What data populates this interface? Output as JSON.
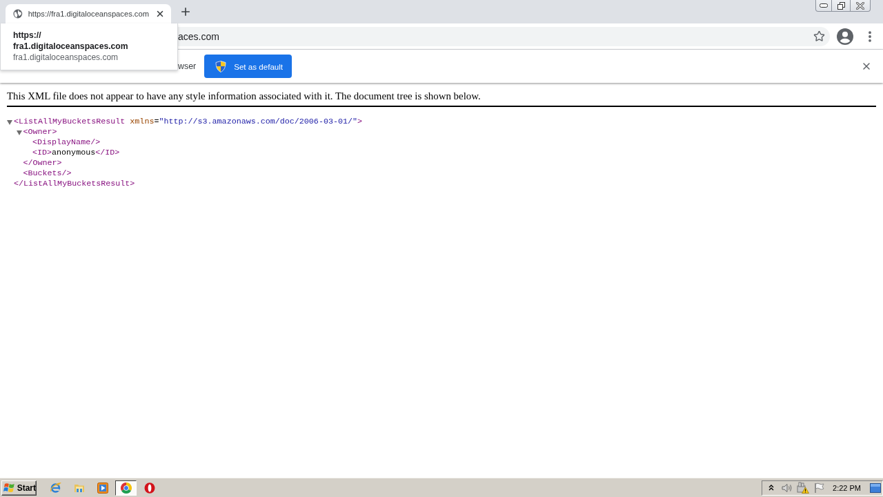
{
  "tabs": [
    {
      "title": "https://fra1.digitaloceanspaces.com",
      "selected": true
    }
  ],
  "hover_card": {
    "title_lines": [
      "https://",
      "fra1.digitaloceanspaces.com"
    ],
    "subtitle": "fra1.digitaloceanspaces.com"
  },
  "toolbar": {
    "address": "aces.com"
  },
  "infobar": {
    "message": "wser",
    "button": "Set as default"
  },
  "page": {
    "notice": "This XML file does not appear to have any style information associated with it. The document tree is shown below.",
    "xml_tree": [
      {
        "kind": "parent",
        "expanded": true,
        "open": [
          {
            "kind": "tag",
            "text": "<ListAllMyBucketsResult"
          },
          {
            "kind": "attr_name",
            "text": "xmlns"
          },
          {
            "kind": "text",
            "text": "="
          },
          {
            "kind": "attr_value",
            "text": "\"http://s3.amazonaws.com/doc/2006-03-01/\""
          },
          {
            "kind": "tag",
            "text": ">"
          }
        ],
        "children": [
          {
            "kind": "parent",
            "expanded": true,
            "open": [
              {
                "kind": "tag",
                "text": "<Owner>"
              }
            ],
            "children": [
              {
                "kind": "leaf",
                "line": [
                  {
                    "kind": "tag",
                    "text": "<DisplayName/>"
                  }
                ]
              },
              {
                "kind": "leaf",
                "line": [
                  {
                    "kind": "tag",
                    "text": "<ID>"
                  },
                  {
                    "kind": "text",
                    "text": "anonymous"
                  },
                  {
                    "kind": "tag",
                    "text": "</ID>"
                  }
                ]
              }
            ],
            "close": [
              {
                "kind": "tag",
                "text": "</Owner>"
              }
            ]
          },
          {
            "kind": "leaf",
            "line": [
              {
                "kind": "tag",
                "text": "<Buckets/>"
              }
            ]
          }
        ],
        "close": [
          {
            "kind": "tag",
            "text": "</ListAllMyBucketsResult>"
          }
        ]
      }
    ]
  },
  "taskbar": {
    "start": "Start",
    "apps": [
      {
        "kind": "e-logo",
        "selected": false
      },
      {
        "kind": "folder",
        "selected": false
      },
      {
        "kind": "play",
        "selected": false
      },
      {
        "kind": "ring-logo",
        "selected": true
      },
      {
        "kind": "o-logo",
        "selected": false
      }
    ],
    "clock": "2:22 PM"
  }
}
